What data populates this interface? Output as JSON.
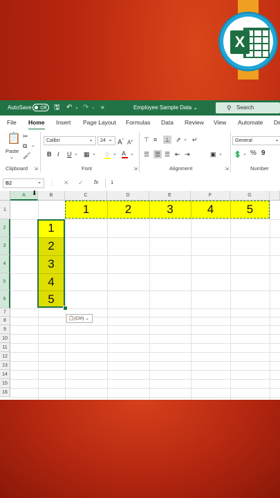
{
  "titlebar": {
    "autosave_label": "AutoSave",
    "autosave_state": "Off",
    "doc_title": "Employee Sample Data",
    "search_label": "Search"
  },
  "tabs": [
    "File",
    "Home",
    "Insert",
    "Page Layout",
    "Formulas",
    "Data",
    "Review",
    "View",
    "Automate",
    "De"
  ],
  "active_tab": "Home",
  "ribbon": {
    "clipboard": {
      "paste_label": "Paste",
      "group_label": "Clipboard"
    },
    "font": {
      "font_name": "Calibri",
      "font_size": "24",
      "grow": "A",
      "shrink": "A",
      "bold": "B",
      "italic": "I",
      "underline": "U",
      "group_label": "Font"
    },
    "alignment": {
      "group_label": "Alignment"
    },
    "number": {
      "format": "General",
      "percent": "%",
      "comma": "9",
      "group_label": "Number"
    }
  },
  "formula_bar": {
    "name_box": "B2",
    "fx": "fx",
    "value": "1"
  },
  "columns": [
    "A",
    "B",
    "C",
    "D",
    "E",
    "F",
    "G"
  ],
  "rows": [
    "1",
    "2",
    "3",
    "4",
    "5",
    "6",
    "7",
    "8",
    "9",
    "10",
    "11",
    "12",
    "13",
    "14",
    "15",
    "16"
  ],
  "row1_values": [
    "1",
    "2",
    "3",
    "4",
    "5"
  ],
  "colB_values": [
    "1",
    "2",
    "3",
    "4",
    "5"
  ],
  "paste_options_label": "(Ctrl)",
  "colors": {
    "excel_green": "#217346",
    "highlight_yellow": "#ffff00",
    "selected_yellow": "#dede00"
  }
}
